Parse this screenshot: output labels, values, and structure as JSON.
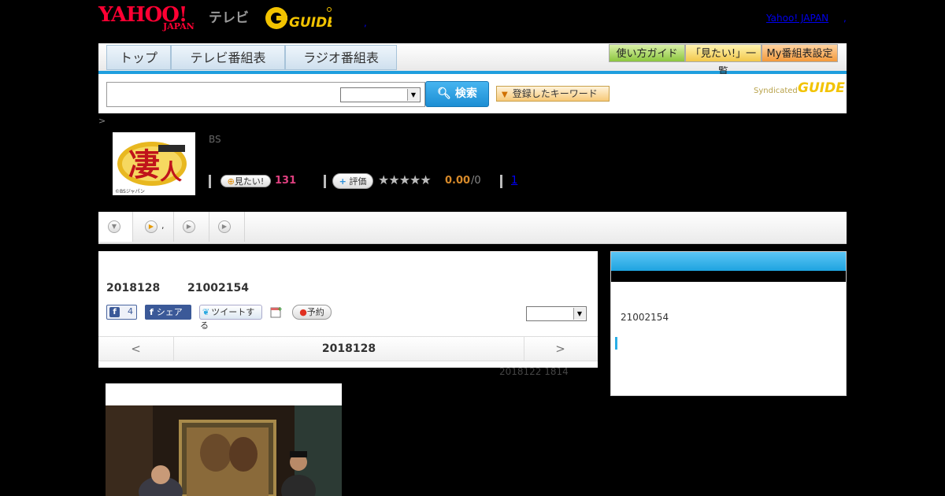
{
  "header": {
    "yahoo_logo": "YAHOO!",
    "japan_logo": "JAPAN",
    "tv_label": "テレビ",
    "gguide_logo": "GUIDE",
    "yahoo_japan_link": "Yahoo! JAPAN",
    "link_separator": ",",
    "dot_link": ","
  },
  "nav": {
    "tabs": [
      {
        "label": "トップ"
      },
      {
        "label": "テレビ番組表"
      },
      {
        "label": "ラジオ番組表"
      }
    ],
    "buttons": [
      {
        "label": "使い方ガイド"
      },
      {
        "label": "「見たい!」一覧"
      },
      {
        "label": "My番組表設定"
      }
    ]
  },
  "search": {
    "input_value": "",
    "select_value": "",
    "search_button": "検索",
    "keyword_button": "登録したキーワード",
    "syndicated_label": "Syndicated",
    "syndicated_logo": "GUIDE"
  },
  "program": {
    "breadcrumb": ">",
    "channel": "BS",
    "thumbnail_caption": "©BSジャパン",
    "mitai_button": "見たい!",
    "mitai_count": "131",
    "hyoka_button": "評価",
    "stars": "★★★★★",
    "score": "0.00",
    "score_count": "/0",
    "link_count": "1"
  },
  "tabs_row": {
    "tab2_text": ","
  },
  "main": {
    "date": "2018128",
    "time": "21002154",
    "fb_like_count": "4",
    "fb_share": "シェア",
    "tweet": "ツイートする",
    "reserve": "予約",
    "pager_prev": "<",
    "pager_date": "2018128",
    "pager_next": ">",
    "updated": "2018122  1814"
  },
  "sidebar": {
    "time": "21002154"
  },
  "colors": {
    "brand_red": "#ff0033",
    "accent_blue": "#1f9ede",
    "gguide_yellow": "#f2c300",
    "mitai_pink": "#e04080",
    "score_orange": "#d88a2a"
  }
}
